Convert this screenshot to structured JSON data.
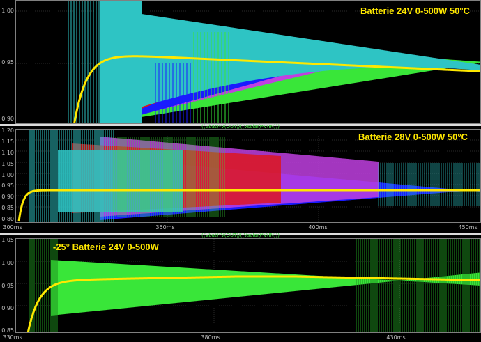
{
  "colors": {
    "yellow": "#ffe800",
    "cyan": "#2ec4c4",
    "green": "#39e639",
    "blue": "#1a1aff",
    "red": "#e01515",
    "purple": "#c040e0",
    "darkgreen": "#1e8f1e",
    "grid": "#555555",
    "label": "#bfbfbf",
    "title_green": "#39d739"
  },
  "panels": [
    {
      "caption": "Batterie 24V 0-500W 50°C",
      "yticks": [
        "1.00",
        "0.95",
        "0.90"
      ],
      "xticks": [],
      "trace_title": ""
    },
    {
      "caption": "Batterie 28V 0-500W 50°C",
      "trace_title": "((Vbat)*V(OUT)/((Vsolar)*V(IN)))",
      "yticks": [
        "1.20",
        "1.15",
        "1.10",
        "1.05",
        "1.00",
        "0.95",
        "0.90",
        "0.85",
        "0.80"
      ],
      "xticks": [
        "300ms",
        "350ms",
        "400ms",
        "450ms"
      ]
    },
    {
      "caption": "-25° Batterie 24V 0-500W",
      "trace_title": "((Vbat)*V(OUT)/((Vsolar)*V(IN)))",
      "yticks": [
        "1.05",
        "1.00",
        "0.95",
        "0.90",
        "0.85"
      ],
      "xticks": [
        "330ms",
        "380ms",
        "430ms"
      ]
    }
  ],
  "chart_data": [
    {
      "type": "line",
      "title": "Batterie 24V 0-500W 50°C",
      "ylim": [
        0.9,
        1.02
      ],
      "x": [
        0,
        0.05,
        0.1,
        0.2,
        0.3,
        0.4,
        0.5,
        0.6,
        0.7,
        0.8,
        0.9,
        1.0
      ],
      "series": [
        {
          "values": [
            0.9,
            0.93,
            0.95,
            0.958,
            0.96,
            0.959,
            0.957,
            0.954,
            0.951,
            0.948,
            0.945,
            0.942
          ]
        }
      ]
    },
    {
      "type": "line",
      "title": "Batterie 28V 0-500W 50°C",
      "xlabel": "",
      "ylim": [
        0.8,
        1.2
      ],
      "x": [
        "300ms",
        "310ms",
        "320ms",
        "350ms",
        "400ms",
        "450ms"
      ],
      "series": [
        {
          "values": [
            0.8,
            0.93,
            0.945,
            0.952,
            0.953,
            0.952
          ]
        }
      ]
    },
    {
      "type": "line",
      "title": "-25° Batterie 24V 0-500W",
      "ylim": [
        0.85,
        1.05
      ],
      "x": [
        "330ms",
        "340ms",
        "350ms",
        "380ms",
        "430ms",
        "480ms"
      ],
      "series": [
        {
          "values": [
            0.85,
            0.93,
            0.95,
            0.96,
            0.958,
            0.952
          ]
        }
      ]
    }
  ]
}
